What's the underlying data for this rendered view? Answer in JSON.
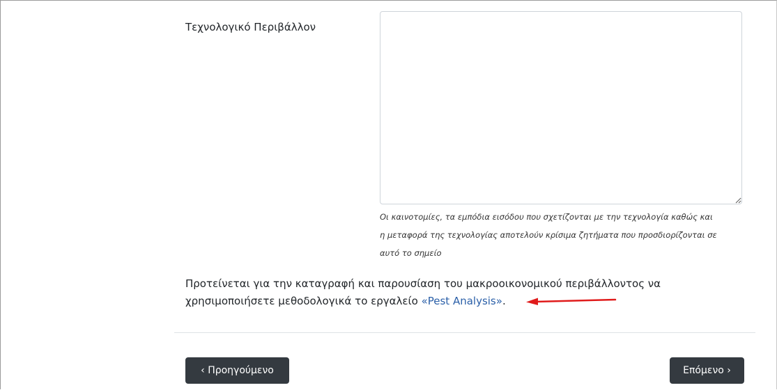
{
  "form": {
    "field_label": "Τεχνολογικό Περιβάλλον",
    "textarea_value": "",
    "help_lines": [
      "Οι καινοτομίες, τα εμπόδια εισόδου που σχετίζονται με την τεχνολογία καθώς και",
      "η μεταφορά της τεχνολογίας αποτελούν κρίσιμα ζητήματα που προσδιορίζονται σε",
      "αυτό το σημείο"
    ]
  },
  "note": {
    "text_line1": "Προτείνεται για την καταγραφή και παρουσίαση του μακροοικονομικού περιβάλλοντος να",
    "text_line2_prefix": "χρησιμοποιήσετε μεθοδολογικά το εργαλείο ",
    "link_text": "«Pest Analysis»",
    "text_suffix": "."
  },
  "nav": {
    "prev_label": "‹ Προηγούμενο",
    "next_label": "Επόμενο ›"
  },
  "colors": {
    "button_bg": "#343a40",
    "link": "#2a5fa8",
    "arrow": "#e01b1b"
  }
}
